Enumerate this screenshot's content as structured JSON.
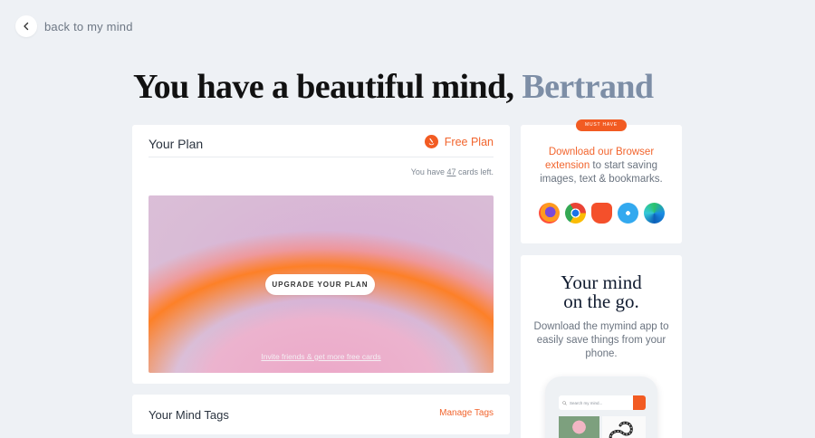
{
  "nav": {
    "back_label": "back to my mind"
  },
  "headline": {
    "greeting": "You have a beautiful mind, ",
    "name": "Bertrand"
  },
  "plan": {
    "title": "Your Plan",
    "plan_label": "Free Plan",
    "cards_left_prefix": "You have ",
    "cards_left_count": "47",
    "cards_left_suffix": " cards left.",
    "upgrade_label": "UPGRADE YOUR PLAN",
    "invite_label": "Invite friends & get more free cards"
  },
  "tags": {
    "title": "Your Mind Tags",
    "manage_label": "Manage Tags"
  },
  "extension": {
    "badge": "MUST HAVE",
    "text_accent": "Download our Browser extension",
    "text_rest": " to start saving images, text & bookmarks.",
    "browsers": [
      "firefox-icon",
      "chrome-icon",
      "brave-icon",
      "safari-icon",
      "edge-icon"
    ]
  },
  "app": {
    "title_line1": "Your mind",
    "title_line2": "on the go.",
    "text": "Download the mymind app to easily save things from your phone.",
    "search_placeholder": "Search my mind..."
  },
  "colors": {
    "accent": "#f25b22",
    "background": "#eef1f5",
    "name_color": "#7d8ea6"
  }
}
